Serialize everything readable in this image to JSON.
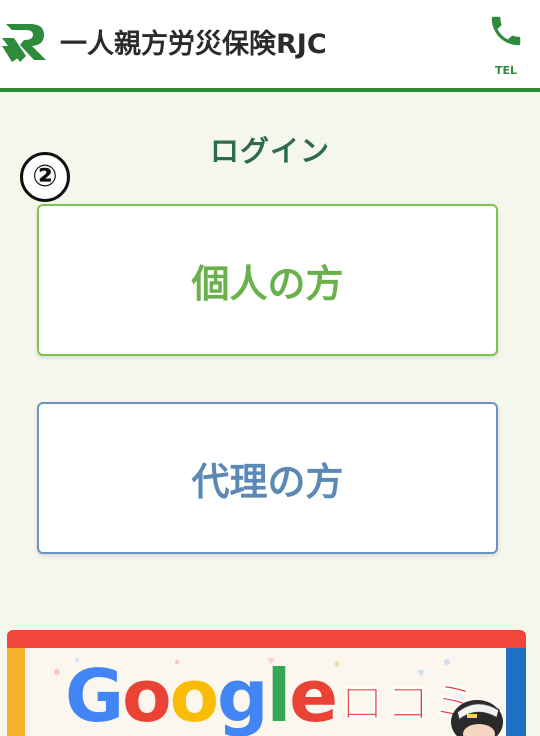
{
  "header": {
    "logo_text": "一人親方労災保険RJC",
    "tel_label": "TEL"
  },
  "main": {
    "title": "ログイン",
    "step_marker": "②",
    "options": [
      {
        "label": "個人の方"
      },
      {
        "label": "代理の方"
      }
    ]
  },
  "banner": {
    "google_letters": [
      "G",
      "o",
      "o",
      "g",
      "l",
      "e"
    ],
    "google_colors": [
      "#4285F4",
      "#EA4335",
      "#FBBC05",
      "#4285F4",
      "#34A853",
      "#EA4335"
    ],
    "kuchikomi": "ロコミ"
  },
  "colors": {
    "brand_green": "#2f8b3c",
    "title_green": "#2d6b4f",
    "individual_green": "#6ab04c",
    "agent_blue": "#5b88b5",
    "banner_red": "#f0463c",
    "banner_yellow": "#f8b22e",
    "banner_blue": "#1f6fc2"
  },
  "icons": {
    "logo": "rjc-logo-icon",
    "tel": "phone-icon"
  }
}
